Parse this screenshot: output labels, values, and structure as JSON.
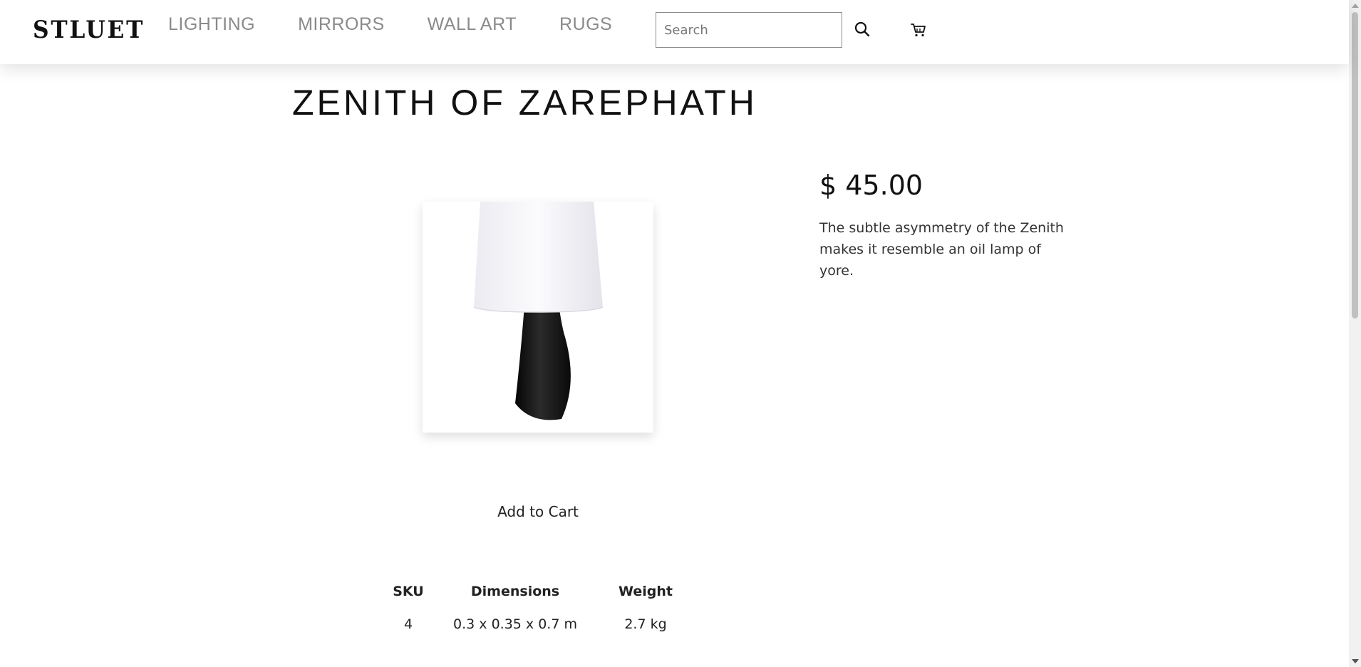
{
  "header": {
    "logo": "STLUET",
    "nav": [
      "LIGHTING",
      "MIRRORS",
      "WALL ART",
      "RUGS"
    ],
    "search_placeholder": "Search",
    "search_icon": "search-icon",
    "cart_icon": "cart-icon"
  },
  "product": {
    "title": "ZENITH OF ZAREPHATH",
    "price": "$ 45.00",
    "description": "The subtle asymmetry of the Zenith makes it resemble an oil lamp of yore.",
    "add_to_cart": "Add to Cart",
    "specs": {
      "headers": [
        "SKU",
        "Dimensions",
        "Weight"
      ],
      "values": [
        "4",
        "0.3 x 0.35 x 0.7 m",
        "2.7 kg"
      ]
    }
  },
  "colors": {
    "nav_text": "#8a8a8a",
    "lamp_base": "#111111",
    "lamp_shade": "#f4f3f7"
  }
}
